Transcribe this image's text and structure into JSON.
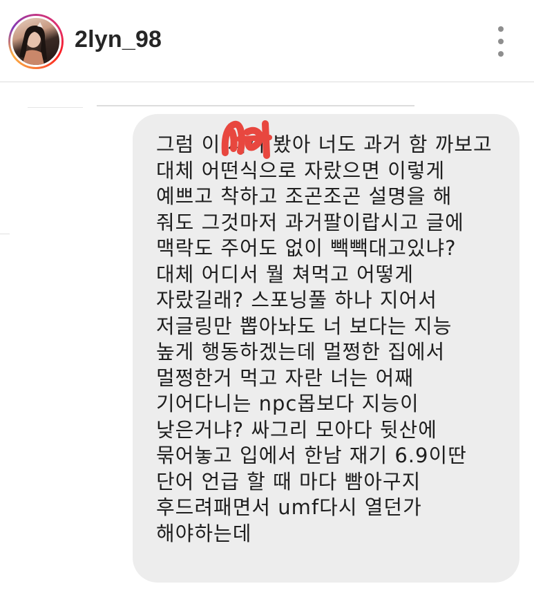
{
  "header": {
    "username": "2lyn_98"
  },
  "message": {
    "lines": [
      "그럼 이 새끼 봤아 너도 과거 함 까보고",
      "대체 어떤식으로 자랐으면 이렇게",
      "예쁘고 착하고 조곤조곤 설명을 해",
      "줘도 그것마저 과거팔이랍시고 글에",
      "맥락도 주어도 없이 빽빽대고있냐?",
      "대체 어디서 뭘 쳐먹고 어떻게",
      "자랐길래? 스포닝풀 하나 지어서",
      "저글링만 뽑아놔도 너 보다는 지능",
      "높게 행동하겠는데 멀쩡한 집에서",
      "멀쩡한거 먹고 자란 너는 어째",
      "기어다니는 npc몹보다 지능이",
      "낮은거냐? 싸그리 모아다 뒷산에",
      "묶어놓고 입에서 한남 재기 6.9이딴",
      "단어 언급 할 때 마다 빰아구지",
      "후드려패면서 umf다시 열던가",
      "해야하는데"
    ]
  },
  "colors": {
    "bubble": "#ededed",
    "text": "#1e1e1e",
    "scribble": "#e8473f",
    "username": "#262626"
  },
  "icons": {
    "more": "vertical-ellipsis-icon",
    "avatar": "profile-photo"
  }
}
